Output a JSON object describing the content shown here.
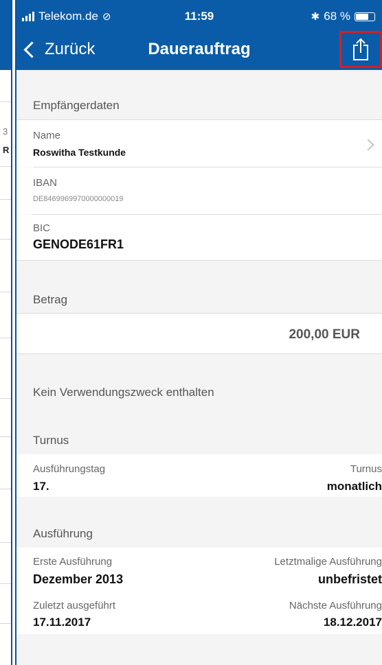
{
  "status_bar": {
    "carrier": "Telekom.de",
    "time": "11:59",
    "battery": "68 %"
  },
  "nav": {
    "back_label": "Zurück",
    "title": "Dauerauftrag"
  },
  "recipient": {
    "header": "Empfängerdaten",
    "name_label": "Name",
    "name_value": "Roswitha Testkunde",
    "iban_label": "IBAN",
    "iban_value": "DE8469969970000000019",
    "bic_label": "BIC",
    "bic_value": "GENODE61FR1"
  },
  "amount": {
    "header": "Betrag",
    "value": "200,00 EUR"
  },
  "purpose": {
    "text": "Kein Verwendungszweck enthalten"
  },
  "turnus": {
    "header": "Turnus",
    "day_label": "Ausführungstag",
    "day_value": "17.",
    "turnus_label": "Turnus",
    "turnus_value": "monatlich"
  },
  "execution": {
    "header": "Ausführung",
    "first_label": "Erste Ausführung",
    "first_value": "Dezember 2013",
    "last_label": "Letztmalige Ausführung",
    "last_value": "unbefristet",
    "latest_label": "Zuletzt ausgeführt",
    "latest_value": "17.11.2017",
    "next_label": "Nächste Ausführung",
    "next_value": "18.12.2017"
  },
  "background_screen": {
    "row_chars": [
      "3",
      "R"
    ]
  },
  "colors": {
    "nav_blue": "#0b5ca8",
    "highlight_red": "#d61f1f"
  }
}
